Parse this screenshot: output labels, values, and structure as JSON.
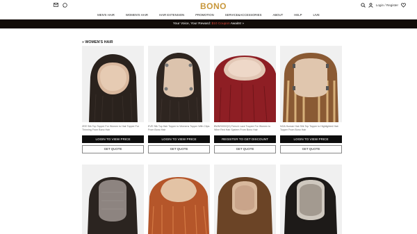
{
  "header": {
    "logo": "BONO",
    "social_icons": [
      "mail-icon",
      "whatsapp-icon"
    ],
    "account_label": "Login / Register",
    "icons": [
      "search-icon",
      "user-icon",
      "wishlist-heart-icon"
    ]
  },
  "nav": {
    "items": [
      "MEN'S HAIR",
      "WOMEN'S HAIR",
      "HAIR EXTENSION",
      "PROMOTION",
      "SERVICE&ACCESSORIES",
      "ABOUT",
      "HELP",
      "LIVE"
    ]
  },
  "promo": {
    "text_before": "Your Voice, Your Reward: ",
    "highlight": "$10 Coupon",
    "text_after": " Awaits! »"
  },
  "section": {
    "title": "» WOMEN'S HAIR"
  },
  "products": [
    {
      "caption": "ZEE Silk Top Topper For Women to Hair Topper For Thinning From Bono Hair",
      "action_label": "LOGIN TO VIEW PRICE",
      "quote_label": "GET QUOTE"
    },
    {
      "caption": "EVE Silk Top Hair Topper to Womens Topper With Clips From Bono Hair",
      "action_label": "LOGIN TO VIEW PRICE",
      "quote_label": "GET QUOTE"
    },
    {
      "caption": "BWNS0002(H) French Lace Toupee For Women to Wine Red Hair System From Bono Hair",
      "action_label": "REGISTER TO GET DISCOUNT",
      "quote_label": "GET QUOTE"
    },
    {
      "caption": "NOA Human Hair Silk Top Topper to Highlighted Hair Topper From Bono Hair",
      "action_label": "LOGIN TO VIEW PRICE",
      "quote_label": "GET QUOTE"
    }
  ],
  "products_row2": [
    {
      "image": "hair-topper-lace-dark"
    },
    {
      "image": "hair-topper-auburn"
    },
    {
      "image": "hair-topper-brown"
    },
    {
      "image": "hair-topper-black"
    }
  ]
}
